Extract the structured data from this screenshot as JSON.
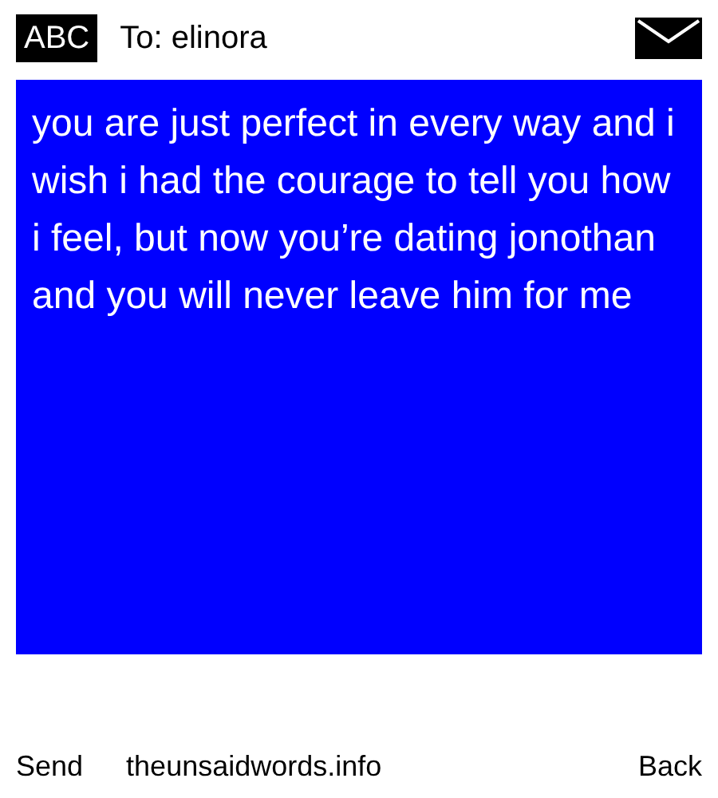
{
  "header": {
    "mode": "ABC",
    "recipient": "To: elinora"
  },
  "message": "you are just perfect in every way and i wish i had the courage to tell you how i feel, but now you’re dating jonothan and you will never leave him for me",
  "footer": {
    "left": "Send",
    "center": "theunsaidwords.info",
    "right": "Back"
  }
}
